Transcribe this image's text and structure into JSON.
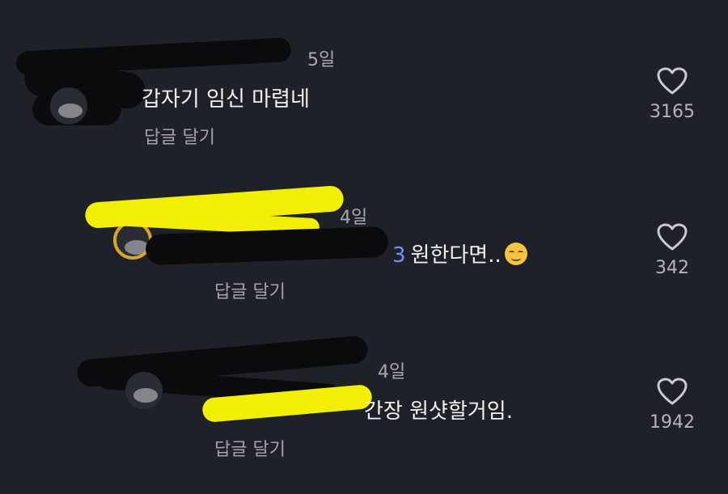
{
  "comments": [
    {
      "time": "5일",
      "text": "갑자기 임신 마렵네",
      "mention_tail": "",
      "emoji": "",
      "reply_label": "답글 달기",
      "likes": "3165"
    },
    {
      "time": "4일",
      "text": "원한다면..",
      "mention_tail": "3",
      "emoji": "smirk-face",
      "reply_label": "답글 달기",
      "likes": "342"
    },
    {
      "time": "4일",
      "text": "간장 원샷할거임.",
      "mention_tail": "",
      "emoji": "",
      "reply_label": "답글 달기",
      "likes": "1942"
    }
  ],
  "colors": {
    "background": "#1f2129",
    "mention": "#7d8cf0",
    "redaction_black": "#0b0b0d",
    "redaction_yellow": "#f2ee06"
  }
}
